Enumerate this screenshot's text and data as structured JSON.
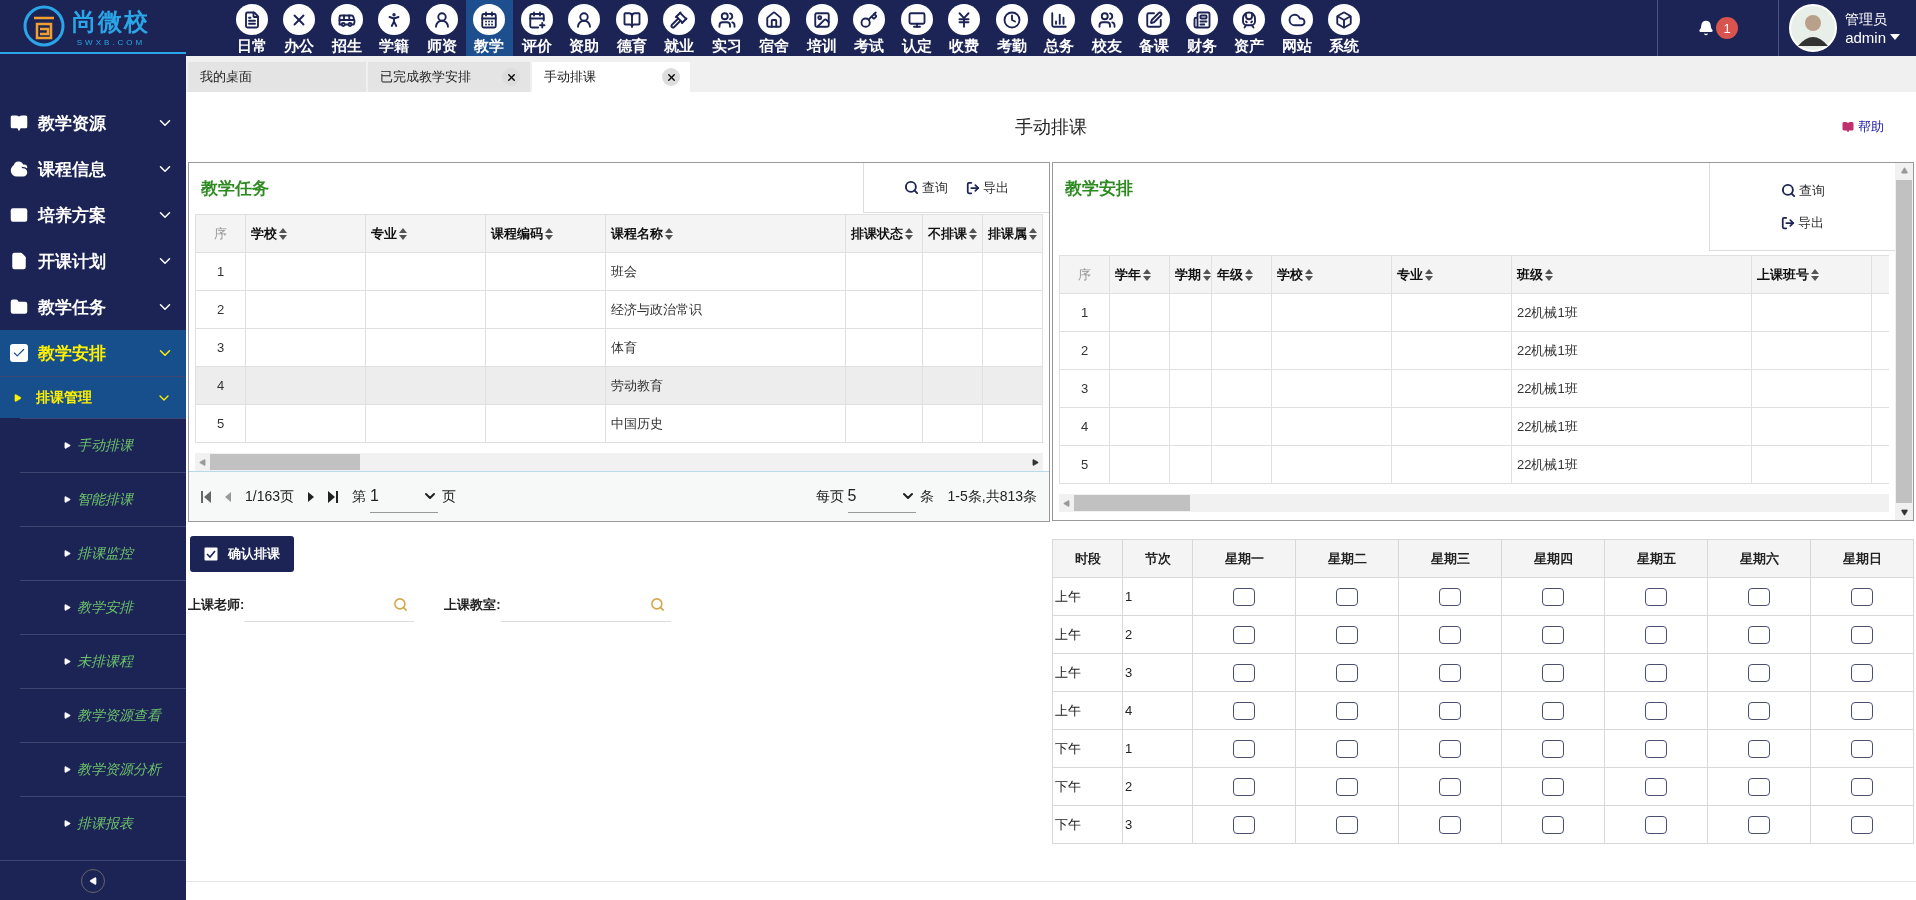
{
  "logo": {
    "name": "尚微校",
    "domain": "SWXB.COM"
  },
  "modules": [
    {
      "label": "日常",
      "selected": false
    },
    {
      "label": "办公",
      "selected": false
    },
    {
      "label": "招生",
      "selected": false
    },
    {
      "label": "学籍",
      "selected": false
    },
    {
      "label": "师资",
      "selected": false
    },
    {
      "label": "教学",
      "selected": true
    },
    {
      "label": "评价",
      "selected": false
    },
    {
      "label": "资助",
      "selected": false
    },
    {
      "label": "德育",
      "selected": false
    },
    {
      "label": "就业",
      "selected": false
    },
    {
      "label": "实习",
      "selected": false
    },
    {
      "label": "宿舍",
      "selected": false
    },
    {
      "label": "培训",
      "selected": false
    },
    {
      "label": "考试",
      "selected": false
    },
    {
      "label": "认定",
      "selected": false
    },
    {
      "label": "收费",
      "selected": false
    },
    {
      "label": "考勤",
      "selected": false
    },
    {
      "label": "总务",
      "selected": false
    },
    {
      "label": "校友",
      "selected": false
    },
    {
      "label": "备课",
      "selected": false
    },
    {
      "label": "财务",
      "selected": false
    },
    {
      "label": "资产",
      "selected": false
    },
    {
      "label": "网站",
      "selected": false
    },
    {
      "label": "系统",
      "selected": false
    }
  ],
  "notifications": {
    "count": "1"
  },
  "user": {
    "role": "管理员",
    "name": "admin"
  },
  "sidebar": {
    "items": [
      {
        "label": "教学资源",
        "selected": false
      },
      {
        "label": "课程信息",
        "selected": false
      },
      {
        "label": "培养方案",
        "selected": false
      },
      {
        "label": "开课计划",
        "selected": false
      },
      {
        "label": "教学任务",
        "selected": false
      },
      {
        "label": "教学安排",
        "selected": true,
        "children": [
          {
            "label": "排课管理",
            "selected": true,
            "children": [
              {
                "label": "手动排课",
                "selected": false
              },
              {
                "label": "智能排课",
                "selected": false
              },
              {
                "label": "排课监控",
                "selected": false
              },
              {
                "label": "教学安排",
                "selected": false
              },
              {
                "label": "未排课程",
                "selected": false
              },
              {
                "label": "教学资源查看",
                "selected": false
              },
              {
                "label": "教学资源分析",
                "selected": false
              },
              {
                "label": "排课报表",
                "selected": false
              }
            ]
          }
        ]
      }
    ]
  },
  "tabs": [
    {
      "label": "我的桌面",
      "selected": false,
      "closable": false
    },
    {
      "label": "已完成教学安排",
      "selected": false,
      "closable": true
    },
    {
      "label": "手动排课",
      "selected": true,
      "closable": true
    }
  ],
  "page": {
    "title": "手动排课",
    "help": "帮助"
  },
  "tasks": {
    "title": "教学任务",
    "actions": [
      "查询",
      "导出"
    ],
    "columns": [
      "序",
      "学校",
      "专业",
      "课程编码",
      "课程名称",
      "排课状态",
      "不排课",
      "排课属"
    ],
    "rows": [
      {
        "index": "1",
        "course_name": "班会",
        "selected": false
      },
      {
        "index": "2",
        "course_name": "经济与政治常识",
        "selected": false
      },
      {
        "index": "3",
        "course_name": "体育",
        "selected": false
      },
      {
        "index": "4",
        "course_name": "劳动教育",
        "selected": true
      },
      {
        "index": "5",
        "course_name": "中国历史",
        "selected": false
      }
    ],
    "pagination": {
      "pages": "1/163页",
      "page_prefix": "第",
      "page": "1",
      "page_suffix": "页",
      "size_prefix": "每页",
      "size": "5",
      "size_suffix": "条",
      "summary": "1-5条,共813条"
    }
  },
  "confirm_button": "确认排课",
  "filters": [
    {
      "label": "上课老师:"
    },
    {
      "label": "上课教室:"
    }
  ],
  "arrangement": {
    "title": "教学安排",
    "actions": [
      "查询",
      "导出"
    ],
    "columns": [
      "序",
      "学年",
      "学期",
      "年级",
      "学校",
      "专业",
      "班级",
      "上课班号"
    ],
    "rows": [
      {
        "index": "1",
        "class": "22机械1班"
      },
      {
        "index": "2",
        "class": "22机械1班"
      },
      {
        "index": "3",
        "class": "22机械1班"
      },
      {
        "index": "4",
        "class": "22机械1班"
      },
      {
        "index": "5",
        "class": "22机械1班"
      }
    ]
  },
  "schedule": {
    "columns": [
      "时段",
      "节次",
      "星期一",
      "星期二",
      "星期三",
      "星期四",
      "星期五",
      "星期六",
      "星期日"
    ],
    "rows": [
      {
        "period": "上午",
        "section": "1",
        "slots": [
          {
            "checked": false
          },
          {
            "checked": false
          },
          {
            "checked": false
          },
          {
            "checked": false
          },
          {
            "checked": false
          },
          {
            "checked": false
          },
          {
            "checked": false
          }
        ]
      },
      {
        "period": "上午",
        "section": "2",
        "slots": [
          {
            "checked": false
          },
          {
            "checked": false
          },
          {
            "checked": false
          },
          {
            "checked": false
          },
          {
            "checked": false
          },
          {
            "checked": false
          },
          {
            "checked": false
          }
        ]
      },
      {
        "period": "上午",
        "section": "3",
        "slots": [
          {
            "checked": false
          },
          {
            "checked": false
          },
          {
            "checked": false
          },
          {
            "checked": false
          },
          {
            "checked": false
          },
          {
            "checked": false
          },
          {
            "checked": false
          }
        ]
      },
      {
        "period": "上午",
        "section": "4",
        "slots": [
          {
            "checked": false
          },
          {
            "checked": false
          },
          {
            "checked": false
          },
          {
            "checked": false
          },
          {
            "checked": false
          },
          {
            "checked": false
          },
          {
            "checked": false
          }
        ]
      },
      {
        "period": "下午",
        "section": "1",
        "slots": [
          {
            "checked": false
          },
          {
            "checked": false
          },
          {
            "checked": false
          },
          {
            "checked": false
          },
          {
            "checked": false
          },
          {
            "checked": false
          },
          {
            "checked": false
          }
        ]
      },
      {
        "period": "下午",
        "section": "2",
        "slots": [
          {
            "checked": false
          },
          {
            "checked": false
          },
          {
            "checked": false
          },
          {
            "checked": false
          },
          {
            "checked": false
          },
          {
            "checked": false
          },
          {
            "checked": false
          }
        ]
      },
      {
        "period": "下午",
        "section": "3",
        "slots": [
          {
            "checked": false
          },
          {
            "checked": false
          },
          {
            "checked": false
          },
          {
            "checked": false
          },
          {
            "checked": false
          },
          {
            "checked": false
          },
          {
            "checked": false
          }
        ]
      }
    ]
  }
}
